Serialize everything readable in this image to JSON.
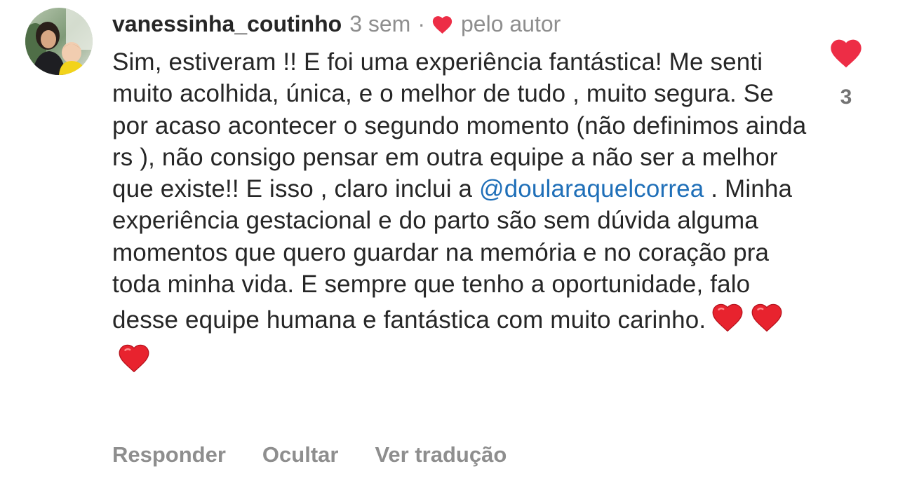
{
  "comment": {
    "username": "vanessinha_coutinho",
    "time_ago": "3 sem",
    "separator": "·",
    "liked_by_author_label": "pelo autor",
    "text_before_mention": "Sim, estiveram !! E foi uma experiência fantástica! Me senti muito acolhida, única, e o melhor de tudo , muito segura. Se por acaso acontecer o segundo momento (não definimos ainda rs ), não consigo pensar em outra equipe a não ser a melhor que existe!! E isso , claro inclui a ",
    "mention": "@doularaquelcorrea",
    "text_after_mention": " . Minha experiência gestacional e do parto são sem dúvida alguma momentos que quero guardar na memória e no coração pra toda minha vida. E sempre que tenho a oportunidade, falo desse equipe humana e fantástica com muito carinho.",
    "emoji_hearts": 3,
    "like_count": "3",
    "colors": {
      "heart_red": "#ed2d46",
      "mention_blue": "#1f6fb8",
      "text": "#262626",
      "muted": "#8e8e8e"
    }
  },
  "actions": {
    "reply": "Responder",
    "hide": "Ocultar",
    "translate": "Ver tradução"
  },
  "icons": {
    "author_like": "heart-icon",
    "like_button": "heart-filled-icon",
    "emoji": "red-heart-emoji"
  }
}
